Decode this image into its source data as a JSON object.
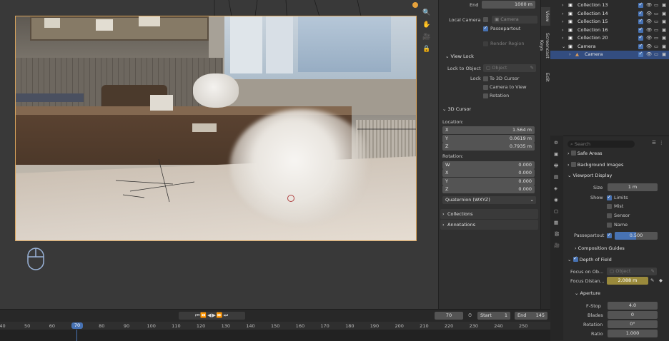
{
  "viewport_tools": {
    "magnify": "🔍",
    "pan": "✋",
    "camera": "🎥",
    "lock": "🔒"
  },
  "npanel": {
    "end_label": "End",
    "end_value": "1000 m",
    "local_camera_label": "Local Camera",
    "local_camera_value": "Camera",
    "passepartout_label": "Passepartout",
    "passepartout_checked": true,
    "render_region_label": "Render Region",
    "view_lock_header": "View Lock",
    "lock_to_object_label": "Lock to Object",
    "lock_to_object_placeholder": "Object",
    "lock_label": "Lock",
    "to_3d_cursor": "To 3D Cursor",
    "camera_to_view": "Camera to View",
    "rotation_lock": "Rotation",
    "cursor_header": "3D Cursor",
    "location_label": "Location:",
    "location": [
      {
        "axis": "X",
        "value": "1.564 m"
      },
      {
        "axis": "Y",
        "value": "0.0619 m"
      },
      {
        "axis": "Z",
        "value": "0.7935 m"
      }
    ],
    "rotation_label": "Rotation:",
    "rotation": [
      {
        "axis": "W",
        "value": "0.000"
      },
      {
        "axis": "X",
        "value": "0.000"
      },
      {
        "axis": "Y",
        "value": "0.000"
      },
      {
        "axis": "Z",
        "value": "0.000"
      }
    ],
    "rotation_mode": "Quaternion (WXYZ)",
    "collections_header": "Collections",
    "annotations_header": "Annotations"
  },
  "side_tabs": [
    "View",
    "Screencast Keys",
    "Edit"
  ],
  "outliner": {
    "rows": [
      {
        "name": "Collection 13",
        "indent": 0
      },
      {
        "name": "Collection 14",
        "indent": 0
      },
      {
        "name": "Collection 15",
        "indent": 0
      },
      {
        "name": "Collection 16",
        "indent": 0
      },
      {
        "name": "Collection 20",
        "indent": 0
      },
      {
        "name": "Camera",
        "indent": 0
      },
      {
        "name": "Camera",
        "indent": 1,
        "selected": true
      }
    ]
  },
  "properties": {
    "search_placeholder": "Search",
    "safe_areas": "Safe Areas",
    "background_images": "Background Images",
    "viewport_display": "Viewport Display",
    "size_label": "Size",
    "size_value": "1 m",
    "show_label": "Show",
    "limits": "Limits",
    "limits_checked": true,
    "mist": "Mist",
    "sensor": "Sensor",
    "name": "Name",
    "passepartout_label": "Passepartout",
    "passepartout_value": "0.500",
    "passepartout_fill": 0.5,
    "composition_guides": "Composition Guides",
    "depth_of_field": "Depth of Field",
    "focus_object_label": "Focus on Ob...",
    "focus_object_placeholder": "Object",
    "focus_distance_label": "Focus Distan...",
    "focus_distance_value": "2.088 m",
    "aperture": "Aperture",
    "fstop_label": "F-Stop",
    "fstop_value": "4.0",
    "blades_label": "Blades",
    "blades_value": "0",
    "rotation_label": "Rotation",
    "rotation_value": "0°",
    "ratio_label": "Ratio",
    "ratio_value": "1.000"
  },
  "timeline": {
    "current_frame": "70",
    "start_label": "Start",
    "start_value": "1",
    "end_label": "End",
    "end_value": "145",
    "marker": "70",
    "ticks": [
      "40",
      "50",
      "60",
      "70",
      "80",
      "90",
      "100",
      "110",
      "120",
      "130",
      "140",
      "150",
      "160",
      "170",
      "180",
      "190",
      "200",
      "210",
      "220",
      "230",
      "240",
      "250"
    ]
  },
  "colors": {
    "accent": "#4772b3",
    "camera_border": "#d9a45c",
    "focus_field": "#9a8a3c",
    "outliner_selected": "#334d80"
  }
}
